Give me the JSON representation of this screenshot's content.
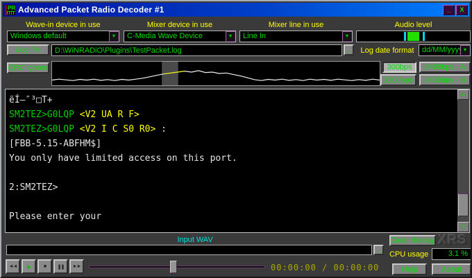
{
  "window": {
    "title": "Advanced Packet Radio Decoder #1",
    "icon_label": "PR",
    "minimize_glyph": "_",
    "close_glyph": "X"
  },
  "icons": {
    "dropdown_arrow": "▼",
    "scroll_up": "▲",
    "scroll_down": "▼"
  },
  "device_row": {
    "wave_in_label": "Wave-in device in use",
    "wave_in_value": "Windows default",
    "mixer_device_label": "Mixer device in use",
    "mixer_device_value": "C-Media Wave Device",
    "mixer_line_label": "Mixer line in use",
    "mixer_line_value": "Line In",
    "audio_level_label": "Audio level",
    "audio_level": {
      "tick_pcts": [
        42,
        58
      ],
      "block_start_pct": 45,
      "block_end_pct": 55
    }
  },
  "log_row": {
    "log_file_button": "Log file",
    "log_path": "D:\\WiNRADiO\\Plugins\\TestPacket.log",
    "browse_button": "...",
    "date_format_label": "Log date format",
    "date_format_value": "dd/MM/yyyy"
  },
  "decoder_row": {
    "crc_button": "CRC ignore",
    "bps_buttons": [
      "300bps",
      "1200bps",
      "2400bps - A",
      "2400bps - B"
    ],
    "active_bps": "300bps"
  },
  "waveform": {
    "selection_start_pct": 33.5,
    "selection_end_pct": 38.5,
    "points_y_pct": [
      78,
      74,
      77,
      80,
      75,
      78,
      74,
      79,
      76,
      80,
      75,
      78,
      74,
      70,
      64,
      58,
      52,
      48,
      44,
      40,
      44,
      38,
      46,
      44,
      50,
      48,
      54,
      60,
      68,
      76,
      80,
      75,
      78,
      74,
      79,
      76,
      80,
      74,
      78,
      75,
      79,
      74,
      77,
      80,
      76,
      79,
      74,
      78
    ]
  },
  "terminal": {
    "lines": [
      {
        "segments": [
          {
            "text": "ëÍ–″³□T+",
            "color": "white"
          }
        ]
      },
      {
        "segments": [
          {
            "text": "SM2TEZ>G0LQP",
            "color": "green"
          },
          {
            "text": " <V2 UA R F>",
            "color": "yellow"
          }
        ]
      },
      {
        "segments": [
          {
            "text": "SM2TEZ>G0LQP",
            "color": "green"
          },
          {
            "text": " <V2 I C S0 R0>",
            "color": "yellow"
          },
          {
            "text": " :",
            "color": "white"
          }
        ]
      },
      {
        "segments": [
          {
            "text": "[FBB-5.15-ABFHM$]",
            "color": "white"
          }
        ]
      },
      {
        "segments": [
          {
            "text": "You only have limited access on this port.",
            "color": "white"
          }
        ]
      },
      {
        "segments": []
      },
      {
        "segments": [
          {
            "text": "2:SM2TEZ>",
            "color": "white"
          }
        ]
      },
      {
        "segments": []
      },
      {
        "segments": [
          {
            "text": "Please enter your",
            "color": "white"
          }
        ]
      }
    ]
  },
  "player": {
    "input_label": "Input WAV",
    "input_value": "",
    "browse_button": "...",
    "transport": [
      {
        "name": "rewind",
        "glyph": "◄◄"
      },
      {
        "name": "play",
        "glyph": "►"
      },
      {
        "name": "stop",
        "glyph": "■"
      },
      {
        "name": "pause",
        "glyph": "❚❚"
      },
      {
        "name": "fast-forward",
        "glyph": "►►"
      }
    ],
    "slider_pos_pct": 48,
    "time_display": "00:00:00 / 00:00:00"
  },
  "status_panel": {
    "clear_button": "Clear display",
    "logo": "XRS",
    "cpu_label": "CPU usage",
    "cpu_value": "3.1 %",
    "help_button": "Help",
    "about_button": "About"
  }
}
